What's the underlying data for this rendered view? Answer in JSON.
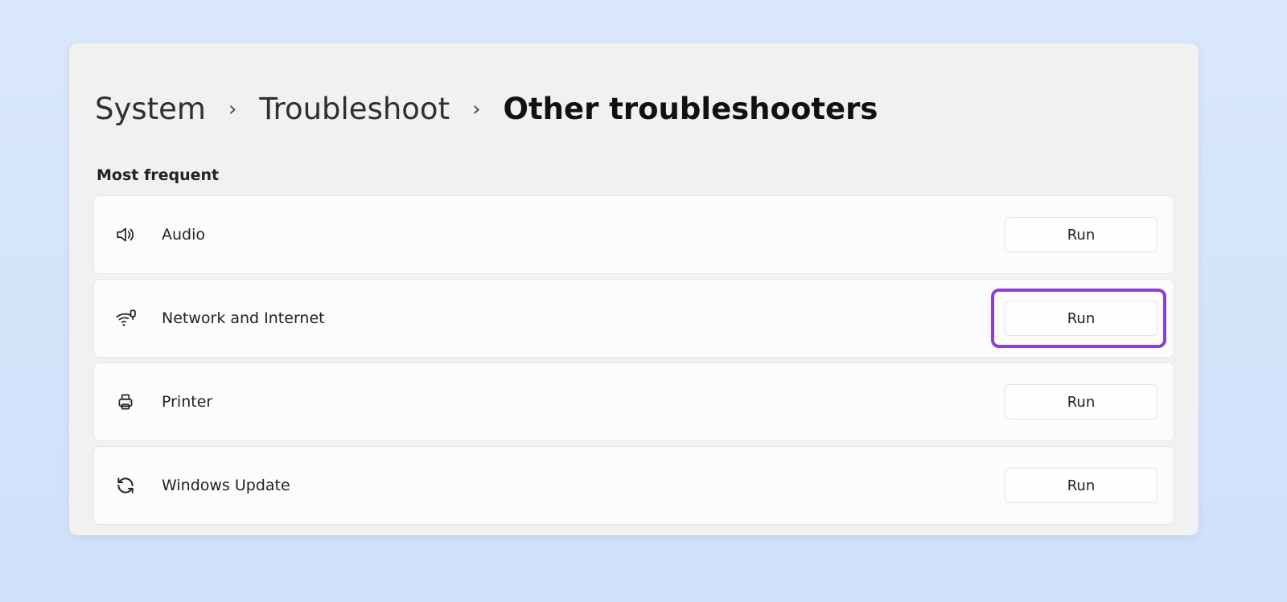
{
  "breadcrumb": {
    "item1": "System",
    "item2": "Troubleshoot",
    "current": "Other troubleshooters",
    "separator": "›"
  },
  "section": {
    "heading": "Most frequent"
  },
  "troubleshooters": [
    {
      "id": "audio",
      "label": "Audio",
      "run_label": "Run",
      "highlighted": false
    },
    {
      "id": "network",
      "label": "Network and Internet",
      "run_label": "Run",
      "highlighted": true
    },
    {
      "id": "printer",
      "label": "Printer",
      "run_label": "Run",
      "highlighted": false
    },
    {
      "id": "update",
      "label": "Windows Update",
      "run_label": "Run",
      "highlighted": false
    }
  ],
  "colors": {
    "highlight": "#8a3fd6",
    "card_bg": "#fcfcfc",
    "window_bg": "#f1f1f1"
  }
}
